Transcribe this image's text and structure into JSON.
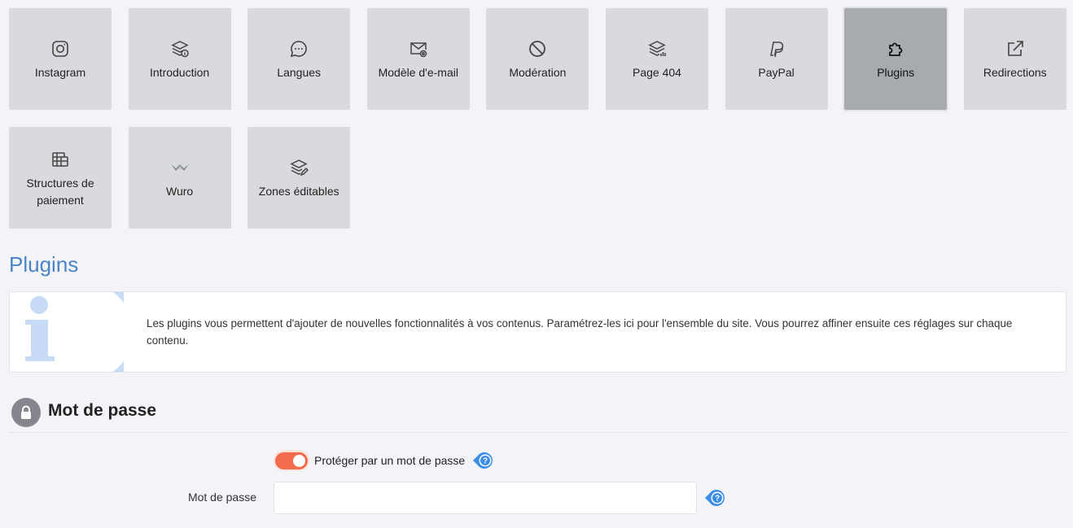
{
  "tiles": [
    {
      "label": "Instagram",
      "icon": "instagram-icon"
    },
    {
      "label": "Introduction",
      "icon": "layers-info-icon"
    },
    {
      "label": "Langues",
      "icon": "speech-bubble-icon"
    },
    {
      "label": "Modèle d'e-mail",
      "icon": "envelope-gear-icon"
    },
    {
      "label": "Modération",
      "icon": "ban-icon"
    },
    {
      "label": "Page 404",
      "icon": "layers-chart-icon"
    },
    {
      "label": "PayPal",
      "icon": "paypal-icon"
    },
    {
      "label": "Plugins",
      "icon": "puzzle-icon",
      "active": true
    },
    {
      "label": "Redirections",
      "icon": "external-link-icon"
    },
    {
      "label": "Structures de paiement",
      "icon": "table-stack-icon"
    },
    {
      "label": "Wuro",
      "icon": "wuro-logo-icon"
    },
    {
      "label": "Zones éditables",
      "icon": "layers-edit-icon"
    }
  ],
  "page": {
    "title": "Plugins",
    "info_text": "Les plugins vous permettent d'ajouter de nouvelles fonctionnalités à vos contenus. Paramétrez-les ici pour l'ensemble du site. Vous pourrez affiner ensuite ces réglages sur chaque contenu."
  },
  "password_section": {
    "title": "Mot de passe",
    "toggle_label": "Protéger par un mot de passe",
    "toggle_on": true,
    "field_label": "Mot de passe",
    "field_value": "",
    "field_placeholder": ""
  },
  "colors": {
    "accent_title": "#4a86c5",
    "toggle_on": "#f26b4c",
    "help_badge": "#3b8ee6",
    "info_watermark": "#c7dbf6"
  }
}
